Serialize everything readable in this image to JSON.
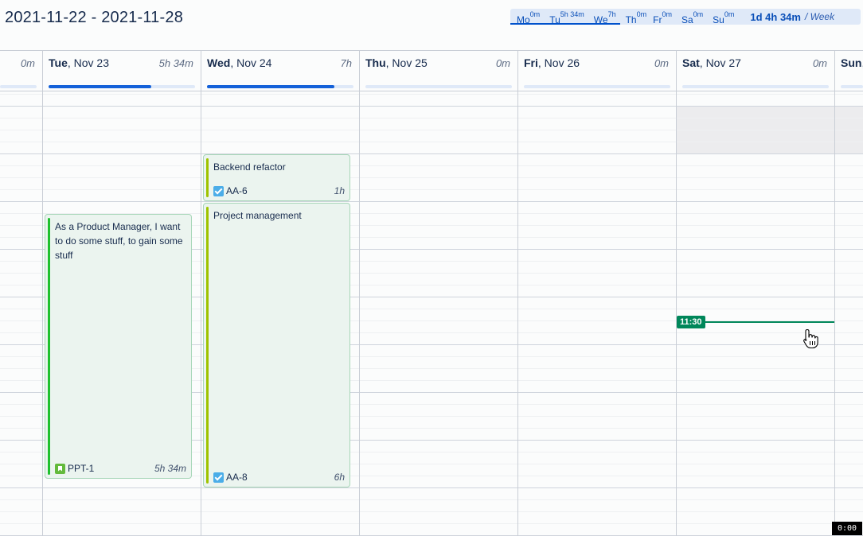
{
  "header": {
    "date_range": "2021-11-22 - 2021-11-28"
  },
  "week_summary": {
    "days": [
      {
        "label": "Mo",
        "time": "0m"
      },
      {
        "label": "Tu",
        "time": "5h 34m"
      },
      {
        "label": "We",
        "time": "7h"
      },
      {
        "label": "Th",
        "time": "0m"
      },
      {
        "label": "Fr",
        "time": "0m"
      },
      {
        "label": "Sa",
        "time": "0m"
      },
      {
        "label": "Su",
        "time": "0m"
      }
    ],
    "total": "1d 4h 34m",
    "per": "/ Week"
  },
  "days": [
    {
      "weekday": "",
      "date": "",
      "total": "0m",
      "progress": 0
    },
    {
      "weekday": "Tue",
      "date": ", Nov 23",
      "total": "5h 34m",
      "progress": 0.7
    },
    {
      "weekday": "Wed",
      "date": ", Nov 24",
      "total": "7h",
      "progress": 0.87
    },
    {
      "weekday": "Thu",
      "date": ", Nov 25",
      "total": "0m",
      "progress": 0
    },
    {
      "weekday": "Fri",
      "date": ", Nov 26",
      "total": "0m",
      "progress": 0
    },
    {
      "weekday": "Sat",
      "date": ", Nov 27",
      "total": "0m",
      "progress": 0
    },
    {
      "weekday": "Sun",
      "date": ",",
      "total": "",
      "progress": 0
    }
  ],
  "events": [
    {
      "title": "Backend refactor",
      "key": "AA-6",
      "duration": "1h",
      "issue_type": "task",
      "stripe_color": "#9fc300"
    },
    {
      "title": "Project management",
      "key": "AA-8",
      "duration": "6h",
      "issue_type": "task",
      "stripe_color": "#9fc300"
    },
    {
      "title": "As a Product Manager, I want to do some stuff, to gain some stuff",
      "key": "PPT-1",
      "duration": "5h 34m",
      "issue_type": "story",
      "stripe_color": "#1fc12e"
    }
  ],
  "now_indicator": {
    "time": "11:30",
    "color": "#00875a"
  },
  "recording_badge": "0:00",
  "colors": {
    "accent": "#0052cc",
    "summary_bg": "#dfe9f8",
    "event_bg": "#ebf4ef",
    "event_border": "#a7d6b8",
    "now": "#00875a"
  }
}
